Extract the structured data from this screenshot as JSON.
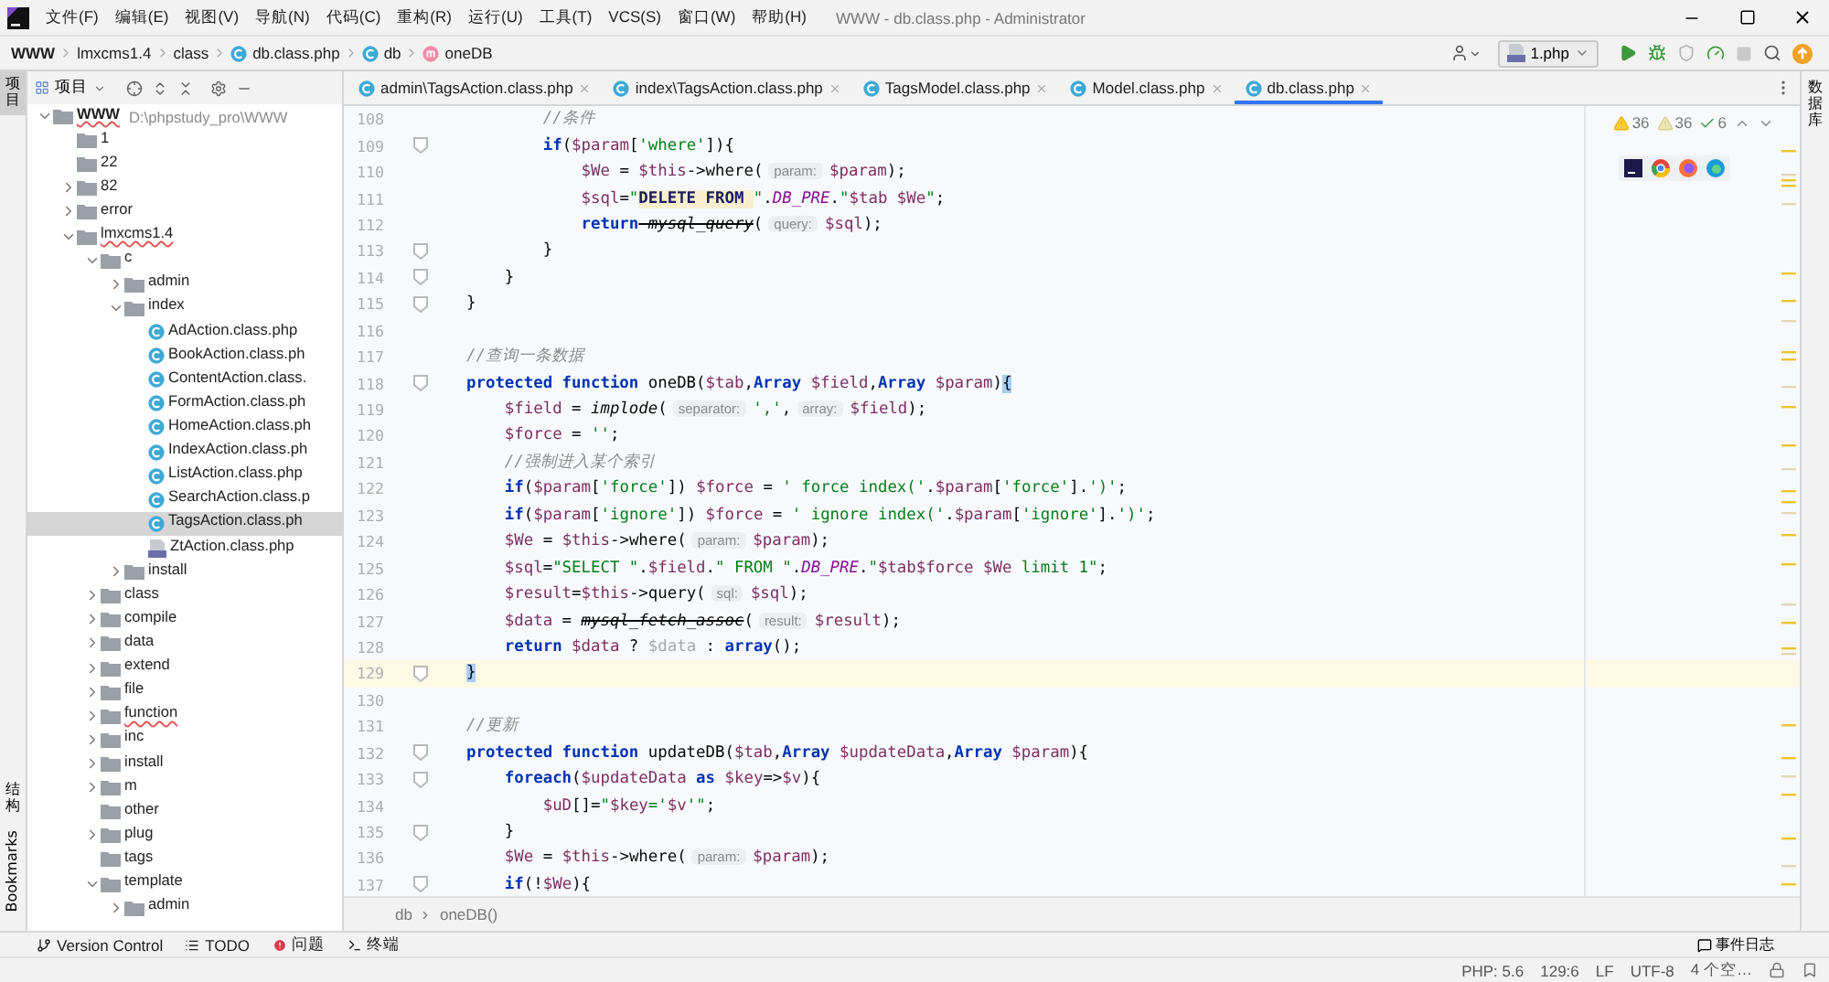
{
  "window": {
    "title": "WWW - db.class.php - Administrator"
  },
  "menu": [
    "文件(F)",
    "编辑(E)",
    "视图(V)",
    "导航(N)",
    "代码(C)",
    "重构(R)",
    "运行(U)",
    "工具(T)",
    "VCS(S)",
    "窗口(W)",
    "帮助(H)"
  ],
  "breadcrumbs": [
    {
      "kind": "project",
      "label": "WWW"
    },
    {
      "kind": "folder",
      "label": "lmxcms1.4"
    },
    {
      "kind": "folder",
      "label": "class"
    },
    {
      "kind": "class",
      "label": "db.class.php"
    },
    {
      "kind": "class",
      "label": "db"
    },
    {
      "kind": "method",
      "label": "oneDB"
    }
  ],
  "run_config": {
    "label": "1.php"
  },
  "tool_windows_left": [
    {
      "label": "项目",
      "kind": "stacked",
      "selected": true
    },
    {
      "label": "结构",
      "kind": "stacked",
      "selected": false
    },
    {
      "label": "Bookmarks",
      "kind": "rotated",
      "selected": false
    }
  ],
  "project_panel": {
    "title": "项目",
    "tree": [
      {
        "label": "WWW",
        "kind": "project",
        "path": "D:\\phpstudy_pro\\WWW",
        "expanded": true,
        "selected": false,
        "typo": true,
        "children": [
          {
            "label": "1",
            "kind": "folder",
            "selected": false,
            "typo": false
          },
          {
            "label": "22",
            "kind": "folder",
            "selected": false,
            "typo": false
          },
          {
            "label": "82",
            "kind": "folder",
            "expanded": false,
            "selected": false,
            "typo": false
          },
          {
            "label": "error",
            "kind": "folder",
            "expanded": false,
            "selected": false,
            "typo": false
          },
          {
            "label": "lmxcms1.4",
            "kind": "folder",
            "expanded": true,
            "selected": false,
            "typo": true,
            "children": [
              {
                "label": "c",
                "kind": "folder",
                "expanded": true,
                "selected": false,
                "typo": false,
                "children": [
                  {
                    "label": "admin",
                    "kind": "folder",
                    "expanded": false,
                    "selected": false,
                    "typo": false
                  },
                  {
                    "label": "index",
                    "kind": "folder",
                    "expanded": true,
                    "selected": false,
                    "typo": false,
                    "children": [
                      {
                        "label": "AdAction.class.php",
                        "kind": "class",
                        "selected": false,
                        "typo": false
                      },
                      {
                        "label": "BookAction.class.ph",
                        "kind": "class",
                        "selected": false,
                        "typo": false
                      },
                      {
                        "label": "ContentAction.class.",
                        "kind": "class",
                        "selected": false,
                        "typo": false
                      },
                      {
                        "label": "FormAction.class.ph",
                        "kind": "class",
                        "selected": false,
                        "typo": false
                      },
                      {
                        "label": "HomeAction.class.ph",
                        "kind": "class",
                        "selected": false,
                        "typo": false
                      },
                      {
                        "label": "IndexAction.class.ph",
                        "kind": "class",
                        "selected": false,
                        "typo": false
                      },
                      {
                        "label": "ListAction.class.php",
                        "kind": "class",
                        "selected": false,
                        "typo": false
                      },
                      {
                        "label": "SearchAction.class.p",
                        "kind": "class",
                        "selected": false,
                        "typo": false
                      },
                      {
                        "label": "TagsAction.class.ph",
                        "kind": "class",
                        "selected": true,
                        "typo": false
                      },
                      {
                        "label": "ZtAction.class.php",
                        "kind": "php",
                        "selected": false,
                        "typo": false
                      }
                    ]
                  },
                  {
                    "label": "install",
                    "kind": "folder",
                    "expanded": false,
                    "selected": false,
                    "typo": false
                  }
                ]
              },
              {
                "label": "class",
                "kind": "folder",
                "expanded": false,
                "selected": false,
                "typo": false
              },
              {
                "label": "compile",
                "kind": "folder",
                "expanded": false,
                "selected": false,
                "typo": false
              },
              {
                "label": "data",
                "kind": "folder",
                "expanded": false,
                "selected": false,
                "typo": false
              },
              {
                "label": "extend",
                "kind": "folder",
                "expanded": false,
                "selected": false,
                "typo": false
              },
              {
                "label": "file",
                "kind": "folder",
                "expanded": false,
                "selected": false,
                "typo": false
              },
              {
                "label": "function",
                "kind": "folder",
                "expanded": false,
                "selected": false,
                "typo": true
              },
              {
                "label": "inc",
                "kind": "folder",
                "expanded": false,
                "selected": false,
                "typo": false
              },
              {
                "label": "install",
                "kind": "folder",
                "expanded": false,
                "selected": false,
                "typo": false
              },
              {
                "label": "m",
                "kind": "folder",
                "expanded": false,
                "selected": false,
                "typo": false
              },
              {
                "label": "other",
                "kind": "folder",
                "selected": false,
                "typo": false
              },
              {
                "label": "plug",
                "kind": "folder",
                "expanded": false,
                "selected": false,
                "typo": false
              },
              {
                "label": "tags",
                "kind": "folder",
                "selected": false,
                "typo": false
              },
              {
                "label": "template",
                "kind": "folder",
                "expanded": true,
                "selected": false,
                "typo": false,
                "children": [
                  {
                    "label": "admin",
                    "kind": "folder",
                    "expanded": false,
                    "selected": false,
                    "typo": false
                  }
                ]
              }
            ]
          }
        ]
      }
    ]
  },
  "editor": {
    "tabs": [
      {
        "label": "admin\\TagsAction.class.php",
        "selected": false
      },
      {
        "label": "index\\TagsAction.class.php",
        "selected": false
      },
      {
        "label": "TagsModel.class.php",
        "selected": false
      },
      {
        "label": "Model.class.php",
        "selected": false
      },
      {
        "label": "db.class.php",
        "selected": true
      }
    ],
    "inspections": [
      {
        "kind": "warning",
        "count": "36"
      },
      {
        "kind": "weak",
        "count": "36"
      },
      {
        "kind": "typo",
        "count": "6"
      }
    ],
    "lines": [
      {
        "number": "108",
        "current": false,
        "fold": false,
        "tokens": [
          {
            "kind": "com",
            "text": "        //条件"
          }
        ]
      },
      {
        "number": "109",
        "current": false,
        "fold": true,
        "tokens": [
          {
            "kind": "kw",
            "text": "        if"
          },
          {
            "kind": "plain",
            "text": "("
          },
          {
            "kind": "var",
            "text": "$param"
          },
          {
            "kind": "plain",
            "text": "["
          },
          {
            "kind": "str",
            "text": "'where'"
          },
          {
            "kind": "plain",
            "text": "]){"
          }
        ]
      },
      {
        "number": "110",
        "current": false,
        "fold": false,
        "tokens": [
          {
            "kind": "var",
            "text": "            $We"
          },
          {
            "kind": "plain",
            "text": " = "
          },
          {
            "kind": "var",
            "text": "$this"
          },
          {
            "kind": "plain",
            "text": "->where("
          },
          {
            "kind": "hint",
            "text": "param:"
          },
          {
            "kind": "var",
            "text": "$param"
          },
          {
            "kind": "plain",
            "text": ");"
          }
        ]
      },
      {
        "number": "111",
        "current": false,
        "fold": false,
        "tokens": [
          {
            "kind": "var",
            "text": "            $sql"
          },
          {
            "kind": "plain",
            "text": "="
          },
          {
            "kind": "str",
            "text": "\""
          },
          {
            "kind": "sql",
            "text": "DELETE FROM "
          },
          {
            "kind": "str",
            "text": "\""
          },
          {
            "kind": "plain",
            "text": "."
          },
          {
            "kind": "const",
            "text": "DB_PRE"
          },
          {
            "kind": "plain",
            "text": "."
          },
          {
            "kind": "str",
            "text": "\""
          },
          {
            "kind": "var",
            "text": "$tab"
          },
          {
            "kind": "var",
            "text": " $We"
          },
          {
            "kind": "str",
            "text": "\""
          },
          {
            "kind": "plain",
            "text": ";"
          }
        ]
      },
      {
        "number": "112",
        "current": false,
        "fold": false,
        "tokens": [
          {
            "kind": "kw",
            "text": "            return"
          },
          {
            "kind": "depr",
            "text": " mysql_query"
          },
          {
            "kind": "plain",
            "text": "("
          },
          {
            "kind": "hint",
            "text": "query:"
          },
          {
            "kind": "var",
            "text": "$sql"
          },
          {
            "kind": "plain",
            "text": ");"
          }
        ]
      },
      {
        "number": "113",
        "current": false,
        "fold": true,
        "tokens": [
          {
            "kind": "plain",
            "text": "        }"
          }
        ]
      },
      {
        "number": "114",
        "current": false,
        "fold": true,
        "tokens": [
          {
            "kind": "plain",
            "text": "    }"
          }
        ]
      },
      {
        "number": "115",
        "current": false,
        "fold": true,
        "tokens": [
          {
            "kind": "plain",
            "text": "}"
          }
        ]
      },
      {
        "number": "116",
        "current": false,
        "fold": false
      },
      {
        "number": "117",
        "current": false,
        "fold": false,
        "tokens": [
          {
            "kind": "com",
            "text": "//查询一条数据"
          }
        ]
      },
      {
        "number": "118",
        "current": false,
        "fold": true,
        "tokens": [
          {
            "kind": "kw",
            "text": "protected function"
          },
          {
            "kind": "plain",
            "text": " oneDB("
          },
          {
            "kind": "var",
            "text": "$tab"
          },
          {
            "kind": "plain",
            "text": ","
          },
          {
            "kind": "kw",
            "text": "Array"
          },
          {
            "kind": "var",
            "text": " $field"
          },
          {
            "kind": "plain",
            "text": ","
          },
          {
            "kind": "kw",
            "text": "Array"
          },
          {
            "kind": "var",
            "text": " $param"
          },
          {
            "kind": "plain",
            "text": ")"
          },
          {
            "kind": "match",
            "text": "{"
          }
        ]
      },
      {
        "number": "119",
        "current": false,
        "fold": false,
        "tokens": [
          {
            "kind": "var",
            "text": "    $field"
          },
          {
            "kind": "plain",
            "text": " = "
          },
          {
            "kind": "call",
            "text": "implode"
          },
          {
            "kind": "plain",
            "text": "("
          },
          {
            "kind": "hint",
            "text": "separator:"
          },
          {
            "kind": "str",
            "text": "','"
          },
          {
            "kind": "plain",
            "text": ","
          },
          {
            "kind": "hint",
            "text": "array:"
          },
          {
            "kind": "var",
            "text": "$field"
          },
          {
            "kind": "plain",
            "text": ");"
          }
        ]
      },
      {
        "number": "120",
        "current": false,
        "fold": false,
        "tokens": [
          {
            "kind": "var",
            "text": "    $force"
          },
          {
            "kind": "plain",
            "text": " = "
          },
          {
            "kind": "str",
            "text": "''"
          },
          {
            "kind": "plain",
            "text": ";"
          }
        ]
      },
      {
        "number": "121",
        "current": false,
        "fold": false,
        "tokens": [
          {
            "kind": "com",
            "text": "    //强制进入某个索引"
          }
        ]
      },
      {
        "number": "122",
        "current": false,
        "fold": false,
        "tokens": [
          {
            "kind": "kw",
            "text": "    if"
          },
          {
            "kind": "plain",
            "text": "("
          },
          {
            "kind": "var",
            "text": "$param"
          },
          {
            "kind": "plain",
            "text": "["
          },
          {
            "kind": "str",
            "text": "'force'"
          },
          {
            "kind": "plain",
            "text": "]) "
          },
          {
            "kind": "var",
            "text": "$force"
          },
          {
            "kind": "plain",
            "text": " = "
          },
          {
            "kind": "str",
            "text": "' force index('"
          },
          {
            "kind": "plain",
            "text": "."
          },
          {
            "kind": "var",
            "text": "$param"
          },
          {
            "kind": "plain",
            "text": "["
          },
          {
            "kind": "str",
            "text": "'force'"
          },
          {
            "kind": "plain",
            "text": "]."
          },
          {
            "kind": "str",
            "text": "')'"
          },
          {
            "kind": "plain",
            "text": ";"
          }
        ]
      },
      {
        "number": "123",
        "current": false,
        "fold": false,
        "tokens": [
          {
            "kind": "kw",
            "text": "    if"
          },
          {
            "kind": "plain",
            "text": "("
          },
          {
            "kind": "var",
            "text": "$param"
          },
          {
            "kind": "plain",
            "text": "["
          },
          {
            "kind": "str",
            "text": "'ignore'"
          },
          {
            "kind": "plain",
            "text": "]) "
          },
          {
            "kind": "var",
            "text": "$force"
          },
          {
            "kind": "plain",
            "text": " = "
          },
          {
            "kind": "str",
            "text": "' ignore index('"
          },
          {
            "kind": "plain",
            "text": "."
          },
          {
            "kind": "var",
            "text": "$param"
          },
          {
            "kind": "plain",
            "text": "["
          },
          {
            "kind": "str",
            "text": "'ignore'"
          },
          {
            "kind": "plain",
            "text": "]."
          },
          {
            "kind": "str",
            "text": "')'"
          },
          {
            "kind": "plain",
            "text": ";"
          }
        ]
      },
      {
        "number": "124",
        "current": false,
        "fold": false,
        "tokens": [
          {
            "kind": "var",
            "text": "    $We"
          },
          {
            "kind": "plain",
            "text": " = "
          },
          {
            "kind": "var",
            "text": "$this"
          },
          {
            "kind": "plain",
            "text": "->where("
          },
          {
            "kind": "hint",
            "text": "param:"
          },
          {
            "kind": "var",
            "text": "$param"
          },
          {
            "kind": "plain",
            "text": ");"
          }
        ]
      },
      {
        "number": "125",
        "current": false,
        "fold": false,
        "tokens": [
          {
            "kind": "var",
            "text": "    $sql"
          },
          {
            "kind": "plain",
            "text": "="
          },
          {
            "kind": "str",
            "text": "\"SELECT \""
          },
          {
            "kind": "plain",
            "text": "."
          },
          {
            "kind": "var",
            "text": "$field"
          },
          {
            "kind": "plain",
            "text": "."
          },
          {
            "kind": "str",
            "text": "\" FROM \""
          },
          {
            "kind": "plain",
            "text": "."
          },
          {
            "kind": "const",
            "text": "DB_PRE"
          },
          {
            "kind": "plain",
            "text": "."
          },
          {
            "kind": "str",
            "text": "\""
          },
          {
            "kind": "var",
            "text": "$tab$force"
          },
          {
            "kind": "var",
            "text": " $We"
          },
          {
            "kind": "str",
            "text": " limit 1\""
          },
          {
            "kind": "plain",
            "text": ";"
          }
        ]
      },
      {
        "number": "126",
        "current": false,
        "fold": false,
        "tokens": [
          {
            "kind": "var",
            "text": "    $result"
          },
          {
            "kind": "plain",
            "text": "="
          },
          {
            "kind": "var",
            "text": "$this"
          },
          {
            "kind": "plain",
            "text": "->query("
          },
          {
            "kind": "hint",
            "text": "sql:"
          },
          {
            "kind": "var",
            "text": "$sql"
          },
          {
            "kind": "plain",
            "text": ");"
          }
        ]
      },
      {
        "number": "127",
        "current": false,
        "fold": false,
        "tokens": [
          {
            "kind": "var",
            "text": "    $data"
          },
          {
            "kind": "plain",
            "text": " = "
          },
          {
            "kind": "depr",
            "text": "mysql_fetch_assoc"
          },
          {
            "kind": "plain",
            "text": "("
          },
          {
            "kind": "hint",
            "text": "result:"
          },
          {
            "kind": "var",
            "text": "$result"
          },
          {
            "kind": "plain",
            "text": ");"
          }
        ]
      },
      {
        "number": "128",
        "current": false,
        "fold": false,
        "tokens": [
          {
            "kind": "kw",
            "text": "    return"
          },
          {
            "kind": "var",
            "text": " $data"
          },
          {
            "kind": "plain",
            "text": " ? "
          },
          {
            "kind": "dim",
            "text": "$data"
          },
          {
            "kind": "plain",
            "text": " : "
          },
          {
            "kind": "kw",
            "text": "array"
          },
          {
            "kind": "plain",
            "text": "();"
          }
        ]
      },
      {
        "number": "129",
        "current": true,
        "fold": true,
        "tokens": [
          {
            "kind": "match",
            "text": "}"
          }
        ]
      },
      {
        "number": "130",
        "current": false,
        "fold": false
      },
      {
        "number": "131",
        "current": false,
        "fold": false,
        "tokens": [
          {
            "kind": "com",
            "text": "//更新"
          }
        ]
      },
      {
        "number": "132",
        "current": false,
        "fold": true,
        "tokens": [
          {
            "kind": "kw",
            "text": "protected function"
          },
          {
            "kind": "plain",
            "text": " updateDB("
          },
          {
            "kind": "var",
            "text": "$tab"
          },
          {
            "kind": "plain",
            "text": ","
          },
          {
            "kind": "kw",
            "text": "Array"
          },
          {
            "kind": "var",
            "text": " $updateData"
          },
          {
            "kind": "plain",
            "text": ","
          },
          {
            "kind": "kw",
            "text": "Array"
          },
          {
            "kind": "var",
            "text": " $param"
          },
          {
            "kind": "plain",
            "text": "){"
          }
        ]
      },
      {
        "number": "133",
        "current": false,
        "fold": true,
        "tokens": [
          {
            "kind": "kw",
            "text": "    foreach"
          },
          {
            "kind": "plain",
            "text": "("
          },
          {
            "kind": "var",
            "text": "$updateData"
          },
          {
            "kind": "kw",
            "text": " as"
          },
          {
            "kind": "var",
            "text": " $key"
          },
          {
            "kind": "plain",
            "text": "=>"
          },
          {
            "kind": "var",
            "text": "$v"
          },
          {
            "kind": "plain",
            "text": "){"
          }
        ]
      },
      {
        "number": "134",
        "current": false,
        "fold": false,
        "tokens": [
          {
            "kind": "var",
            "text": "        $uD"
          },
          {
            "kind": "plain",
            "text": "[]="
          },
          {
            "kind": "str",
            "text": "\""
          },
          {
            "kind": "var",
            "text": "$key"
          },
          {
            "kind": "str",
            "text": "='"
          },
          {
            "kind": "var",
            "text": "$v"
          },
          {
            "kind": "str",
            "text": "'\""
          },
          {
            "kind": "plain",
            "text": ";"
          }
        ]
      },
      {
        "number": "135",
        "current": false,
        "fold": true,
        "tokens": [
          {
            "kind": "plain",
            "text": "    }"
          }
        ]
      },
      {
        "number": "136",
        "current": false,
        "fold": false,
        "tokens": [
          {
            "kind": "var",
            "text": "    $We"
          },
          {
            "kind": "plain",
            "text": " = "
          },
          {
            "kind": "var",
            "text": "$this"
          },
          {
            "kind": "plain",
            "text": "->where("
          },
          {
            "kind": "hint",
            "text": "param:"
          },
          {
            "kind": "var",
            "text": "$param"
          },
          {
            "kind": "plain",
            "text": ");"
          }
        ]
      },
      {
        "number": "137",
        "current": false,
        "fold": true,
        "tokens": [
          {
            "kind": "kw",
            "text": "    if"
          },
          {
            "kind": "plain",
            "text": "(!"
          },
          {
            "kind": "var",
            "text": "$We"
          },
          {
            "kind": "plain",
            "text": "){"
          }
        ]
      }
    ],
    "breadcrumb": [
      "db",
      "oneDB()"
    ]
  },
  "right_stripe": {
    "label": "数据库"
  },
  "tool_bar": [
    {
      "kind": "vcs",
      "label": "Version Control"
    },
    {
      "kind": "todo",
      "label": "TODO"
    },
    {
      "kind": "problems",
      "label": "问题"
    },
    {
      "kind": "terminal",
      "label": "终端"
    }
  ],
  "event_log": {
    "label": "事件日志"
  },
  "status_bar": [
    "PHP: 5.6",
    "129:6",
    "LF",
    "UTF-8",
    "4 个空…"
  ]
}
